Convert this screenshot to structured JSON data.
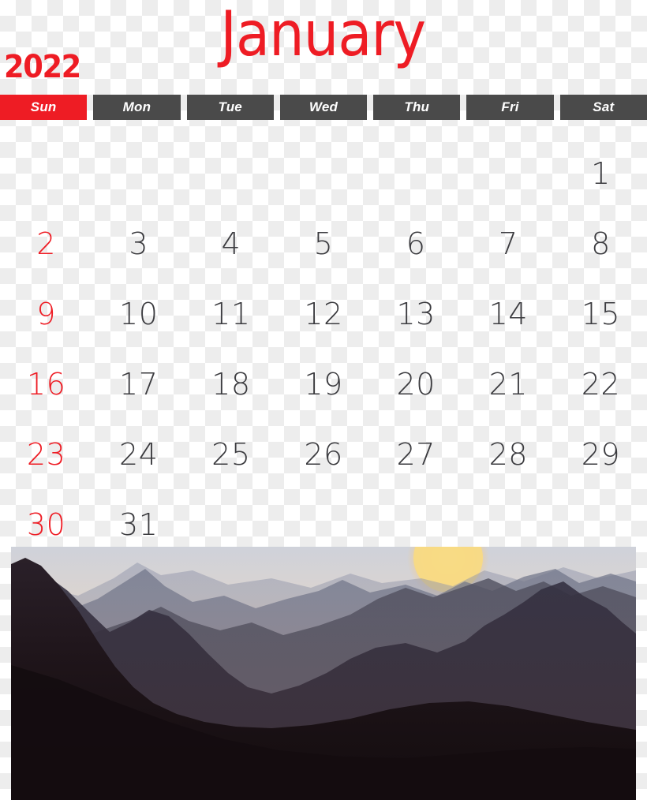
{
  "calendar": {
    "month": "January",
    "year": "2022",
    "accent_red": "#ee1c24",
    "header_gray": "#4a4a4a",
    "number_color": "#3b3b3f",
    "weekdays": [
      {
        "label": "Sun",
        "highlight": true
      },
      {
        "label": "Mon",
        "highlight": false
      },
      {
        "label": "Tue",
        "highlight": false
      },
      {
        "label": "Wed",
        "highlight": false
      },
      {
        "label": "Thu",
        "highlight": false
      },
      {
        "label": "Fri",
        "highlight": false
      },
      {
        "label": "Sat",
        "highlight": false
      }
    ],
    "weeks": [
      [
        "",
        "",
        "",
        "",
        "",
        "",
        "1"
      ],
      [
        "2",
        "3",
        "4",
        "5",
        "6",
        "7",
        "8"
      ],
      [
        "9",
        "10",
        "11",
        "12",
        "13",
        "14",
        "15"
      ],
      [
        "16",
        "17",
        "18",
        "19",
        "20",
        "21",
        "22"
      ],
      [
        "23",
        "24",
        "25",
        "26",
        "27",
        "28",
        "29"
      ],
      [
        "30",
        "31",
        "",
        "",
        "",
        "",
        ""
      ]
    ]
  },
  "photo": {
    "subject": "sunset-mountain-landscape",
    "sky_top": "#d9dae0",
    "sky_glow": "#f7c9a0",
    "sky_horizon": "#f2a583",
    "sun_color": "#f7db7e",
    "ridge_far": "#9aa0b4",
    "ridge_mid": "#6d7187",
    "ridge_near": "#4a4a5c",
    "ridge_dark": "#2a2733",
    "foreground": "#1a1114"
  }
}
